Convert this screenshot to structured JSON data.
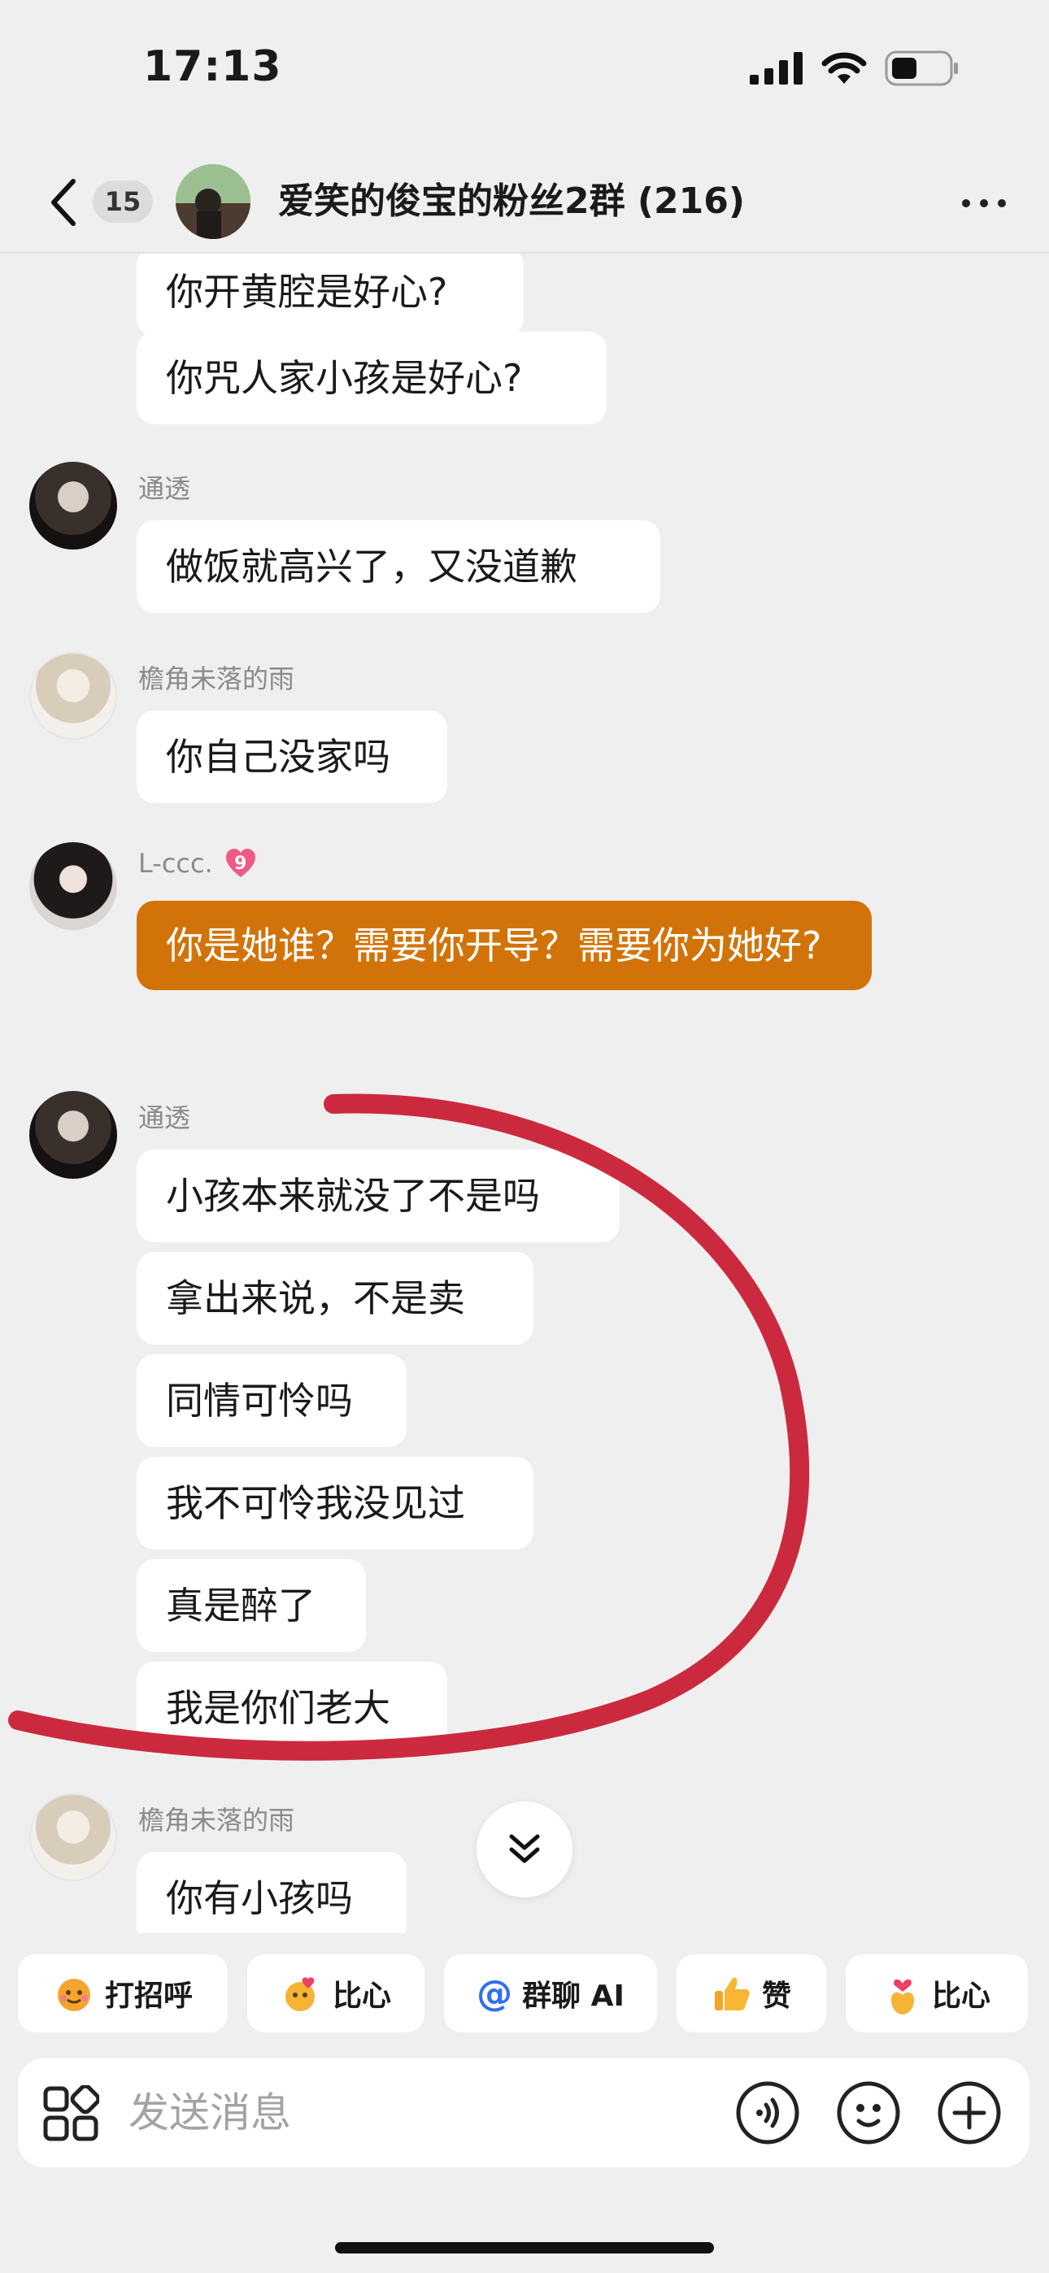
{
  "status_bar": {
    "time": "17:13"
  },
  "header": {
    "unread_count": "15",
    "title": "爱笑的俊宝的粉丝2群 (216)"
  },
  "messages": [
    {
      "sender": "",
      "texts": [
        "你开黄腔是好心?",
        "你咒人家小孩是好心?"
      ]
    },
    {
      "sender": "通透",
      "texts": [
        "做饭就高兴了，又没道歉"
      ]
    },
    {
      "sender": "檐角未落的雨",
      "texts": [
        "你自己没家吗"
      ]
    },
    {
      "sender": "L-ccc.",
      "level": "9",
      "texts": [
        "你是她谁？需要你开导？需要你为她好?"
      ]
    },
    {
      "sender": "通透",
      "texts": [
        "小孩本来就没了不是吗",
        "拿出来说，不是卖",
        "同情可怜吗",
        "我不可怜我没见过",
        "真是醉了",
        "我是你们老大"
      ]
    },
    {
      "sender": "檐角未落的雨",
      "texts": [
        "你有小孩吗"
      ]
    }
  ],
  "quick_actions": [
    {
      "label": "打招呼",
      "icon": "wave-emoji-icon"
    },
    {
      "label": "比心",
      "icon": "heart-hands-emoji-icon"
    },
    {
      "label": "群聊 AI",
      "icon": "at-icon"
    },
    {
      "label": "赞",
      "icon": "thumbs-up-icon"
    },
    {
      "label": "比心",
      "icon": "finger-heart-icon"
    }
  ],
  "input": {
    "placeholder": "发送消息"
  },
  "colors": {
    "own_bubble": "#d27309",
    "annotation_stroke": "#c8192f",
    "background": "#efefef"
  }
}
